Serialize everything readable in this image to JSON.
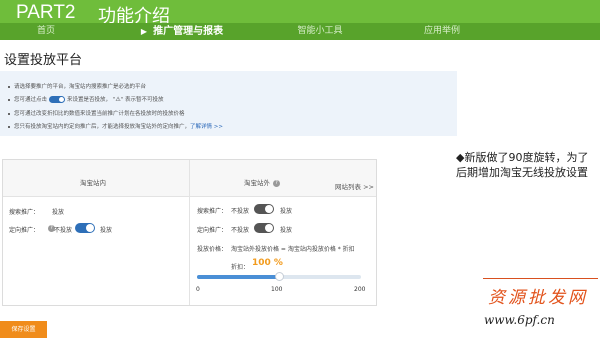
{
  "banner": {
    "part": "PART2",
    "title": "功能介绍"
  },
  "nav": {
    "items": [
      {
        "label": "首页"
      },
      {
        "label": "推广管理与报表",
        "active": true
      },
      {
        "label": "智能小工具"
      },
      {
        "label": "应用举例"
      }
    ],
    "active_arrow": "▶"
  },
  "page_title": "设置投放平台",
  "notice": {
    "line1": "请选择要推广的平台，淘宝站内搜索推广是必选的平台",
    "line2_pre": "您可通过点击",
    "line2_mid": "来设置是否投放，",
    "line2_post": "\" 表示暂不可投放",
    "line3": "您可通过改变折扣比的数值来设置当前推广计划在各投放时的投放价格",
    "line4_pre": "您只有投放淘宝站内的定向推广后，才能选择投放淘宝站外的定向推广，",
    "line4_link": "了解详情 >>"
  },
  "panel": {
    "left_header": "淘宝站内",
    "right_header": "淘宝站外",
    "right_link": "网站列表 >>",
    "left_rows": {
      "search_label": "搜索推广：",
      "search_value": "投放",
      "target_label": "定向推广：",
      "target_off": "不投放",
      "target_on": "投放"
    },
    "right_rows": {
      "search_label": "搜索推广：",
      "search_off": "不投放",
      "search_on": "投放",
      "target_label": "定向推广：",
      "target_off": "不投放",
      "target_on": "投放",
      "price_label": "投放价格：",
      "price_formula": "淘宝站外投放价格 = 淘宝站内投放价格 * 折扣",
      "discount_label": "折扣：",
      "discount_value": "100 %"
    },
    "slider": {
      "min": "0",
      "mid": "100",
      "max": "200",
      "value_fraction": 0.5
    }
  },
  "save_button": "保存设置",
  "annotation": {
    "line1": "◆新版做了90度旋转，为了",
    "line2": "后期增加淘宝无线投放设置"
  },
  "watermark": {
    "text": "资源批发网",
    "url": "www.6pf.cn"
  },
  "colors": {
    "banner": "#6fbd3b",
    "nav": "#58a32b",
    "toggle_on": "#2e6fb8",
    "toggle_off": "#555555",
    "accent_orange": "#f08c1b",
    "link": "#2a67b8",
    "watermark": "#e2531c"
  },
  "icons": [
    "help-icon",
    "warning-icon",
    "toggle-switch"
  ]
}
